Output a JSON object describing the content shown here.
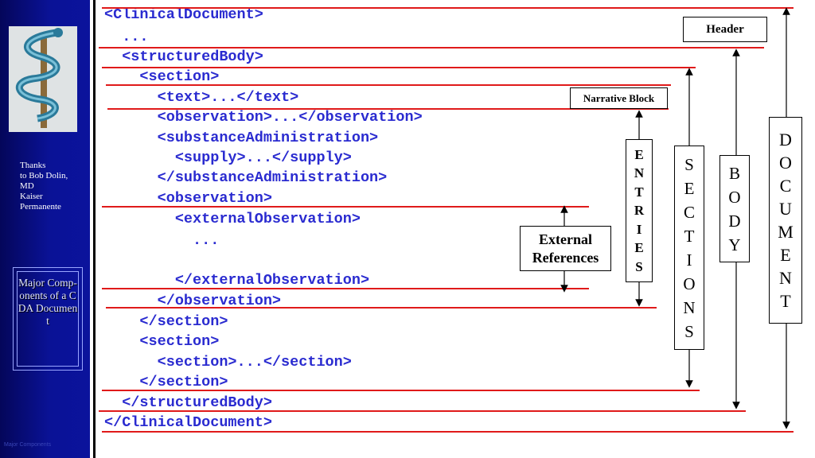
{
  "sidebar": {
    "logo_icon": "caduceus-icon",
    "thanks_text": "Thanks\nto Bob Dolin,\nMD\nKaiser\nPermanente",
    "major_box_text": "Major Comp-onents of a CDA Document",
    "footer_text": "Major Components"
  },
  "code_lines": [
    "<ClinicalDocument>",
    "  ...",
    "  <structuredBody>",
    "    <section>",
    "      <text>...</text>",
    "      <observation>...</observation>",
    "      <substanceAdministration>",
    "        <supply>...</supply>",
    "      </substanceAdministration>",
    "      <observation>",
    "        <externalObservation>",
    "          ...",
    "",
    "        </externalObservation>",
    "      </observation>",
    "    </section>",
    "    <section>",
    "      <section>...</section>",
    "    </section>",
    "  </structuredBody>",
    "</ClinicalDocument>"
  ],
  "labels": {
    "header": "Header",
    "narrative_block": "Narrative Block",
    "external_references": "External\nReferences",
    "entries": [
      "E",
      "N",
      "T",
      "R",
      "I",
      "E",
      "S"
    ],
    "sections": [
      "S",
      "E",
      "C",
      "T",
      "I",
      "O",
      "N",
      "S"
    ],
    "body": [
      "B",
      "O",
      "D",
      "Y"
    ],
    "document": [
      "D",
      "O",
      "C",
      "U",
      "M",
      "E",
      "N",
      "T"
    ]
  },
  "colors": {
    "code": "#2a2bd0",
    "rule": "#e01a1a",
    "sidebar": "#0b139c"
  }
}
